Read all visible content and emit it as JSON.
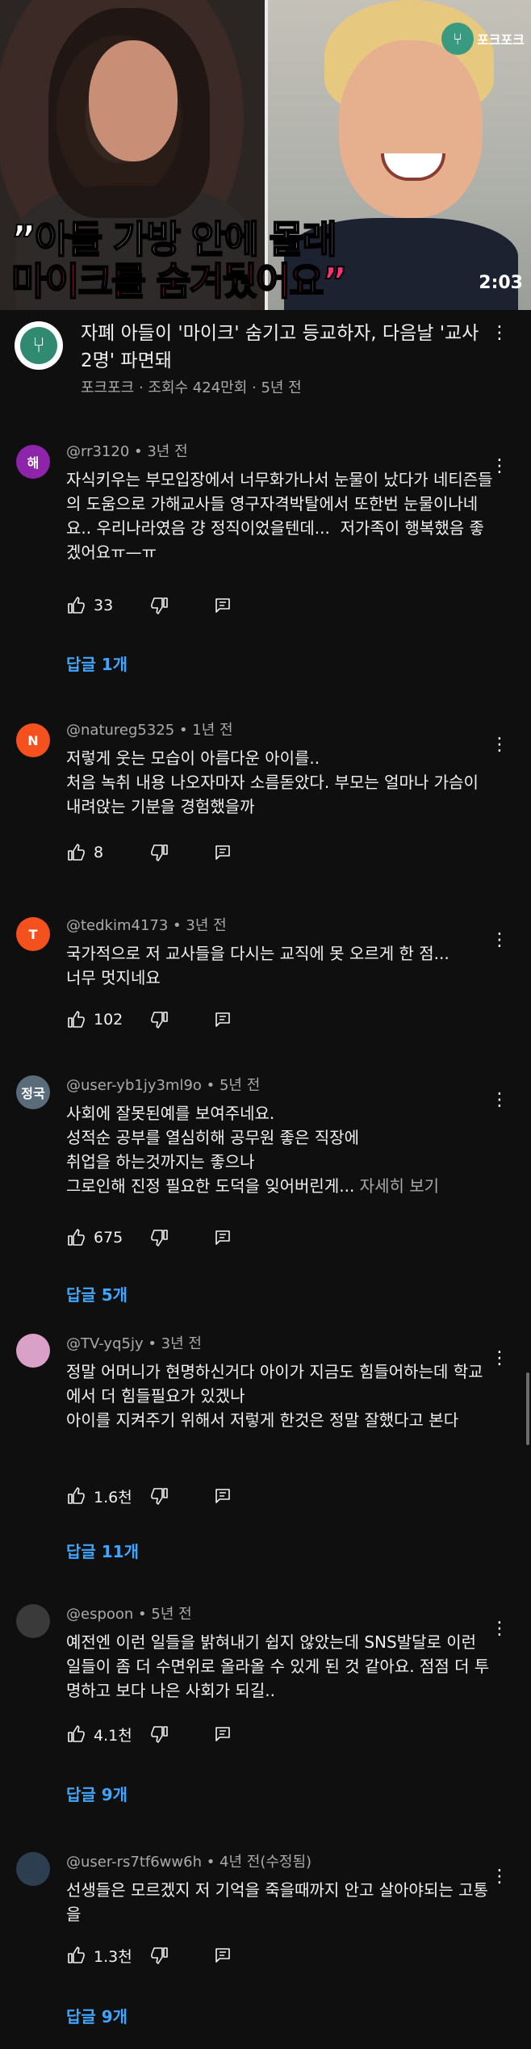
{
  "video": {
    "caption_line1": "”아들 가방 안에 몰래",
    "caption_line2": "마이크를 숨겨뒀어요”",
    "duration": "2:03",
    "channel_badge": "포크포크"
  },
  "info": {
    "title": "자폐 아들이 '마이크' 숨기고 등교하자, 다음날 '교사 2명' 파면돼",
    "meta": "포크포크 · 조회수 424만회 · 5년 전",
    "more_icon": "⋮"
  },
  "comments": [
    {
      "avatar_text": "해",
      "avatar_color": "#8e24aa",
      "head": "@rr3120 • 3년 전",
      "body": "자식키우는 부모입장에서 너무화가나서 눈물이 났다가 네티즌들의 도움으로 가해교사들 영구자격박탈에서 또한번 눈물이나네요.. 우리나라였음 걍 정직이었을텐데...  저가족이 행복했음 좋겠어요ㅠ—ㅠ",
      "likes": "33",
      "replies": "답글 1개"
    },
    {
      "avatar_text": "N",
      "avatar_color": "#f4511e",
      "head": "@natureg5325 • 1년 전",
      "body": "저렇게 웃는 모습이 아름다운 아이를..\n처음 녹취 내용 나오자마자 소름돋았다. 부모는 얼마나 가슴이 내려앉는 기분을 경험했을까",
      "likes": "8",
      "replies": ""
    },
    {
      "avatar_text": "T",
      "avatar_color": "#f4511e",
      "head": "@tedkim4173 • 3년 전",
      "body": "국가적으로 저 교사들을 다시는 교직에 못 오르게 한 점...\n너무 멋지네요",
      "likes": "102",
      "replies": ""
    },
    {
      "avatar_text": "정국",
      "avatar_color": "#5a6b7a",
      "head": "@user-yb1jy3ml9o • 5년 전",
      "body": "사회에 잘못된예를 보여주네요.\n성적순 공부를 열심히해 공무원 좋은 직장에\n취업을 하는것까지는 좋으나\n그로인해 진정 필요한 도덕을 잊어버린게...",
      "read_more": "자세히 보기",
      "likes": "675",
      "replies": "답글 5개"
    },
    {
      "avatar_text": "",
      "avatar_color": "#d9a0c8",
      "head": "@TV-yq5jy • 3년 전",
      "body": "정말 어머니가 현명하신거다 아이가 지금도 힘들어하는데 학교에서 더 힘들필요가 있겠나\n아이를 지켜주기 위해서 저렇게 한것은 정말 잘했다고 본다",
      "likes": "1.6천",
      "replies": "답글 11개"
    },
    {
      "avatar_text": "",
      "avatar_color": "#3a3a3a",
      "head": "@espoon • 5년 전",
      "body": "예전엔 이런 일들을 밝혀내기 쉽지 않았는데 SNS발달로 이런 일들이 좀 더 수면위로 올라올 수 있게 된 것 같아요. 점점 더 투명하고 보다 나은 사회가 되길..",
      "likes": "4.1천",
      "replies": "답글 9개"
    },
    {
      "avatar_text": "",
      "avatar_color": "#2c3e50",
      "head": "@user-rs7tf6ww6h • 4년 전(수정됨)",
      "body": "선생들은 모르겠지 저 기억을 죽을때까지 안고 살아야되는 고통을",
      "likes": "1.3천",
      "replies": "답글 9개"
    }
  ]
}
